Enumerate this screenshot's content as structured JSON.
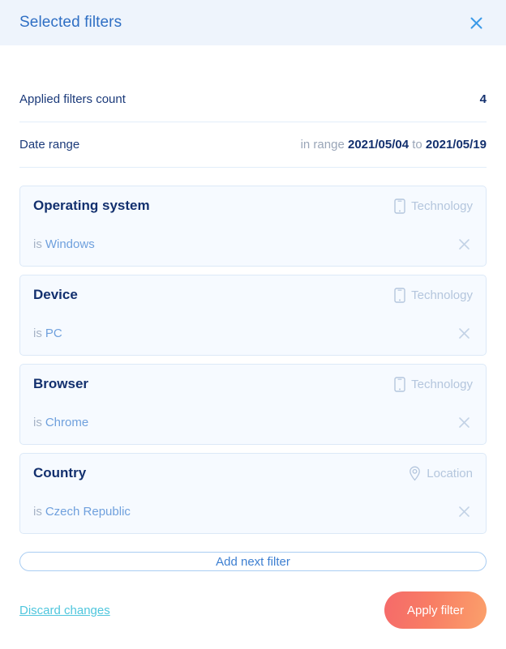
{
  "header": {
    "title": "Selected filters",
    "close_icon": "close-icon"
  },
  "summary": {
    "applied_count_label": "Applied filters count",
    "applied_count_value": "4",
    "date_range_label": "Date range",
    "date_range_prefix": "in range",
    "date_range_from": "2021/05/04",
    "date_range_separator": "to",
    "date_range_to": "2021/05/19"
  },
  "filters": [
    {
      "name": "Operating system",
      "category": "Technology",
      "category_icon": "mobile-device-icon",
      "operator": "is",
      "value": "Windows",
      "remove_icon": "close-icon"
    },
    {
      "name": "Device",
      "category": "Technology",
      "category_icon": "mobile-device-icon",
      "operator": "is",
      "value": "PC",
      "remove_icon": "close-icon"
    },
    {
      "name": "Browser",
      "category": "Technology",
      "category_icon": "mobile-device-icon",
      "operator": "is",
      "value": "Chrome",
      "remove_icon": "close-icon"
    },
    {
      "name": "Country",
      "category": "Location",
      "category_icon": "map-pin-icon",
      "operator": "is",
      "value": "Czech Republic",
      "remove_icon": "close-icon"
    }
  ],
  "actions": {
    "add_filter_label": "Add next filter",
    "discard_label": "Discard changes",
    "apply_label": "Apply filter"
  },
  "colors": {
    "header_bg": "#eef4fc",
    "title": "#2f6fc4",
    "navy": "#13306e",
    "muted": "#a6b3c6",
    "value_blue": "#6fa0dd",
    "card_bg": "#f6faff",
    "card_border": "#dce9f7",
    "link_cyan": "#4fc6dd",
    "apply_gradient_from": "#f56a6a",
    "apply_gradient_to": "#fba06b"
  }
}
